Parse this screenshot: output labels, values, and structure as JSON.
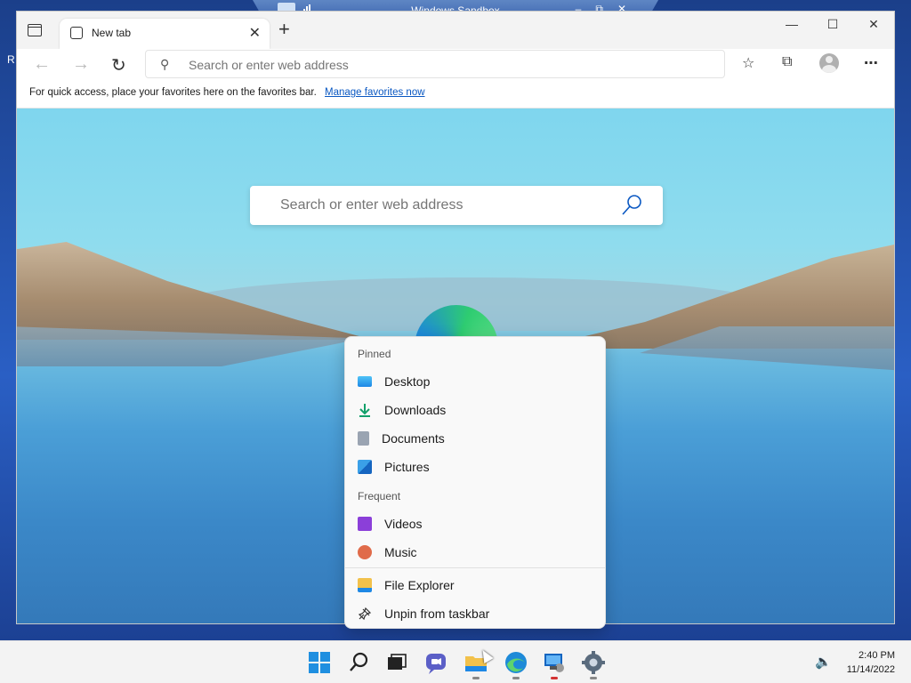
{
  "sandbox": {
    "title": "Windows Sandbox"
  },
  "browser": {
    "tab": {
      "label": "New tab"
    },
    "address_placeholder": "Search or enter web address",
    "favorites_bar": {
      "text": "For quick access, place your favorites here on the favorites bar.",
      "link": "Manage favorites now"
    },
    "ntp_search_placeholder": "Search or enter web address"
  },
  "jumplist": {
    "pinned_header": "Pinned",
    "pinned": [
      {
        "label": "Desktop",
        "icon": "desktop-icon"
      },
      {
        "label": "Downloads",
        "icon": "downloads-icon"
      },
      {
        "label": "Documents",
        "icon": "documents-icon"
      },
      {
        "label": "Pictures",
        "icon": "pictures-icon"
      }
    ],
    "frequent_header": "Frequent",
    "frequent": [
      {
        "label": "Videos",
        "icon": "videos-icon"
      },
      {
        "label": "Music",
        "icon": "music-icon"
      }
    ],
    "actions": [
      {
        "label": "File Explorer",
        "icon": "file-explorer-icon"
      },
      {
        "label": "Unpin from taskbar",
        "icon": "unpin-icon"
      }
    ]
  },
  "taskbar": {
    "time": "2:40 PM",
    "date": "11/14/2022"
  },
  "colors": {
    "accent": "#0a58c2",
    "folder": "#f2c14b",
    "start": "#1f8fe0"
  }
}
